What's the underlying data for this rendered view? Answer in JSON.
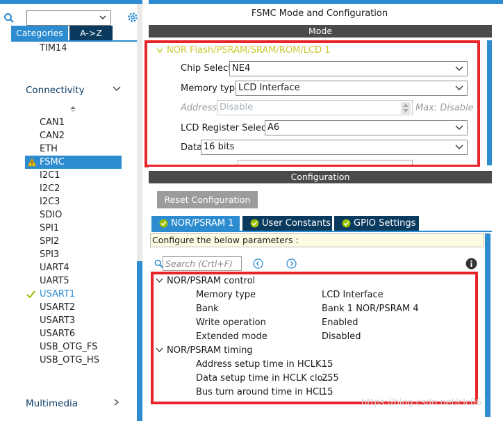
{
  "left": {
    "tabs": [
      "Categories",
      "A->Z"
    ],
    "top_item": "TIM14",
    "categories": {
      "connectivity": "Connectivity",
      "multimedia": "Multimedia"
    },
    "items": [
      "CAN1",
      "CAN2",
      "ETH",
      "FSMC",
      "I2C1",
      "I2C2",
      "I2C3",
      "SDIO",
      "SPI1",
      "SPI2",
      "SPI3",
      "UART4",
      "UART5",
      "USART1",
      "USART2",
      "USART3",
      "USART6",
      "USB_OTG_FS",
      "USB_OTG_HS"
    ],
    "selected": "FSMC",
    "warning_item": "FSMC",
    "ok_item": "USART1"
  },
  "right": {
    "title": "FSMC Mode and Configuration",
    "mode_header": "Mode",
    "mode_section": "NOR Flash/PSRAM/SRAM/ROM/LCD 1",
    "fields": {
      "chip_select": {
        "label": "Chip Select",
        "value": "NE4"
      },
      "memory_type": {
        "label": "Memory type",
        "value": "LCD Interface"
      },
      "address": {
        "label": "Address",
        "value": "Disable",
        "max": "Max: Disable"
      },
      "lcd_register": {
        "label": "LCD Register Select",
        "value": "A6"
      },
      "data": {
        "label": "Data",
        "value": "16 bits"
      }
    },
    "config_header": "Configuration",
    "reset_button": "Reset Configuration",
    "config_tabs": [
      "NOR/PSRAM 1",
      "User Constants",
      "GPIO Settings"
    ],
    "configure_text": "Configure the below parameters :",
    "search_placeholder": "Search (Crtl+F)",
    "tree": {
      "control_header": "NOR/PSRAM control",
      "control": [
        {
          "k": "Memory type",
          "v": "LCD Interface"
        },
        {
          "k": "Bank",
          "v": "Bank 1 NOR/PSRAM 4"
        },
        {
          "k": "Write operation",
          "v": "Enabled"
        },
        {
          "k": "Extended mode",
          "v": "Disabled"
        }
      ],
      "timing_header": "NOR/PSRAM timing",
      "timing": [
        {
          "k": "Address setup time in HCLK...",
          "v": "15"
        },
        {
          "k": "Data setup time in HCLK clo...",
          "v": "255"
        },
        {
          "k": "Bus turn around time in HCL...",
          "v": "15"
        }
      ]
    },
    "watermark": "https://blog.csdn.net/clc06"
  },
  "colors": {
    "accent": "#2d8ccf",
    "dark_tab": "#0a3b5f",
    "highlight": "#e8232a",
    "mode_section": "#c8c832"
  }
}
